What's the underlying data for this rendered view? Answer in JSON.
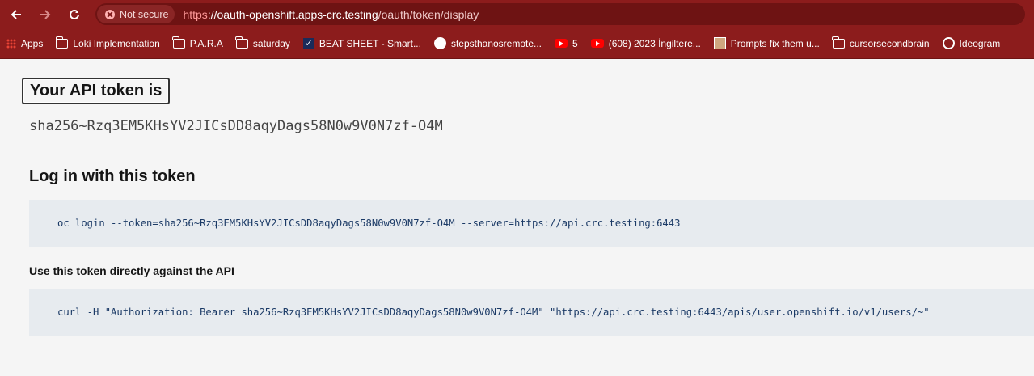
{
  "browser": {
    "security_chip": "Not secure",
    "url_scheme": "https",
    "url_host": "://oauth-openshift.apps-crc.testing",
    "url_path": "/oauth/token/display"
  },
  "bookmarks": [
    {
      "label": "Apps",
      "icon": "apps-grid-icon"
    },
    {
      "label": "Loki Implementation",
      "icon": "folder-icon"
    },
    {
      "label": "P.A.R.A",
      "icon": "folder-icon"
    },
    {
      "label": "saturday",
      "icon": "folder-icon"
    },
    {
      "label": "BEAT SHEET - Smart...",
      "icon": "beat-sheet-icon"
    },
    {
      "label": "stepsthanosremote...",
      "icon": "github-icon"
    },
    {
      "label": "5",
      "icon": "youtube-icon"
    },
    {
      "label": "(608) 2023 İngiltere...",
      "icon": "youtube-icon"
    },
    {
      "label": "Prompts fix them u...",
      "icon": "avatar-icon"
    },
    {
      "label": "cursorsecondbrain",
      "icon": "folder-icon"
    },
    {
      "label": "Ideogram",
      "icon": "ideogram-icon"
    }
  ],
  "page": {
    "title": "Your API token is",
    "token": "sha256~Rzq3EM5KHsYV2JICsDD8aqyDags58N0w9V0N7zf-O4M",
    "login_heading": "Log in with this token",
    "login_command": "oc login --token=sha256~Rzq3EM5KHsYV2JICsDD8aqyDags58N0w9V0N7zf-O4M --server=https://api.crc.testing:6443",
    "api_heading": "Use this token directly against the API",
    "curl_command": "curl -H \"Authorization: Bearer sha256~Rzq3EM5KHsYV2JICsDD8aqyDags58N0w9V0N7zf-O4M\" \"https://api.crc.testing:6443/apis/user.openshift.io/v1/users/~\""
  }
}
